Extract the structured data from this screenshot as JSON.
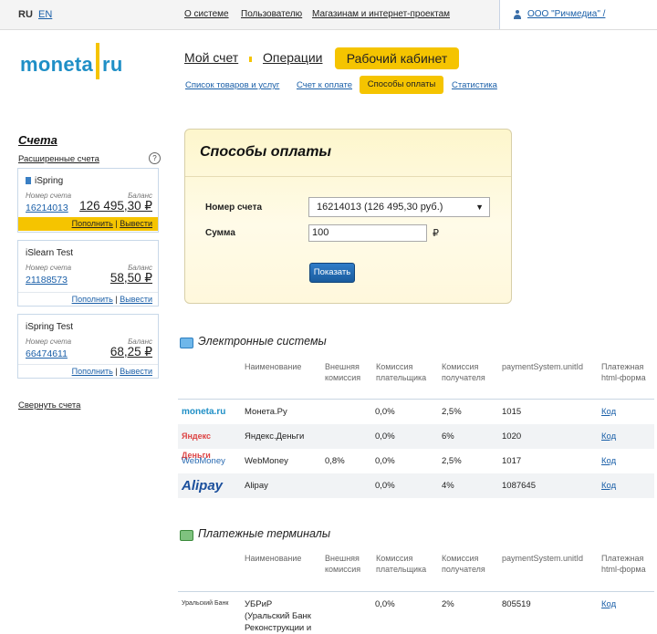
{
  "top": {
    "lang_ru": "RU",
    "lang_en": "EN",
    "nav": [
      "О системе",
      "Пользователю",
      "Магазинам и интернет-проектам"
    ],
    "user": "ООО \"Ричмедиа\" /"
  },
  "logo": {
    "left": "moneta",
    "right": "ru"
  },
  "tabs": {
    "main": [
      "Мой счет",
      "Операции"
    ],
    "active": "Рабочий кабинет",
    "sub": [
      "Список товаров и услуг",
      "Счет к оплате"
    ],
    "sub_active": "Способы оплаты",
    "sub_last": "Статистика"
  },
  "sidebar": {
    "title": "Счета",
    "subtitle": "Расширенные счета",
    "help": "?",
    "label_number": "Номер счета",
    "label_balance": "Баланс",
    "topup": "Пополнить",
    "sep": "|",
    "withdraw": "Вывести",
    "accounts": [
      {
        "name": "iSpring",
        "number": "16214013",
        "balance": "126 495,30 ₽"
      },
      {
        "name": "iSlearn Test",
        "number": "21188573",
        "balance": "58,50 ₽"
      },
      {
        "name": "iSpring Test",
        "number": "66474611",
        "balance": "68,25 ₽"
      }
    ],
    "collapse": "Свернуть счета"
  },
  "form": {
    "title": "Способы оплаты",
    "account_label": "Номер счета",
    "account_value": "16214013 (126 495,30 руб.)",
    "sum_label": "Сумма",
    "sum_value": "100",
    "currency": "₽",
    "show_button": "Показать"
  },
  "columns": {
    "name": "Наименование",
    "ext_fee": "Внешняя комиссия",
    "payer_fee": "Комиссия плательщика",
    "recv_fee": "Комиссия получателя",
    "unit_id": "paymentSystem.unitId",
    "form": "Платежная html-форма"
  },
  "electronic": {
    "title": "Электронные системы",
    "rows": [
      {
        "logo": "moneta.ru",
        "name": "Монета.Ру",
        "ext": "",
        "payer": "0,0%",
        "recv": "2,5%",
        "id": "1015",
        "code": "Код"
      },
      {
        "logo": "Яндекс Деньги",
        "name": "Яндекс.Деньги",
        "ext": "",
        "payer": "0,0%",
        "recv": "6%",
        "id": "1020",
        "code": "Код"
      },
      {
        "logo": "WebMoney",
        "name": "WebMoney",
        "ext": "0,8%",
        "payer": "0,0%",
        "recv": "2,5%",
        "id": "1017",
        "code": "Код"
      },
      {
        "logo": "Alipay",
        "name": "Alipay",
        "ext": "",
        "payer": "0,0%",
        "recv": "4%",
        "id": "1087645",
        "code": "Код"
      }
    ]
  },
  "terminals": {
    "title": "Платежные терминалы",
    "rows": [
      {
        "logo": "Уральский Банк",
        "name_lines": [
          "УБРиР",
          "(Уральский Банк",
          "Реконструкции и"
        ],
        "ext": "",
        "payer": "0,0%",
        "recv": "2%",
        "id": "805519",
        "code": "Код"
      }
    ]
  }
}
